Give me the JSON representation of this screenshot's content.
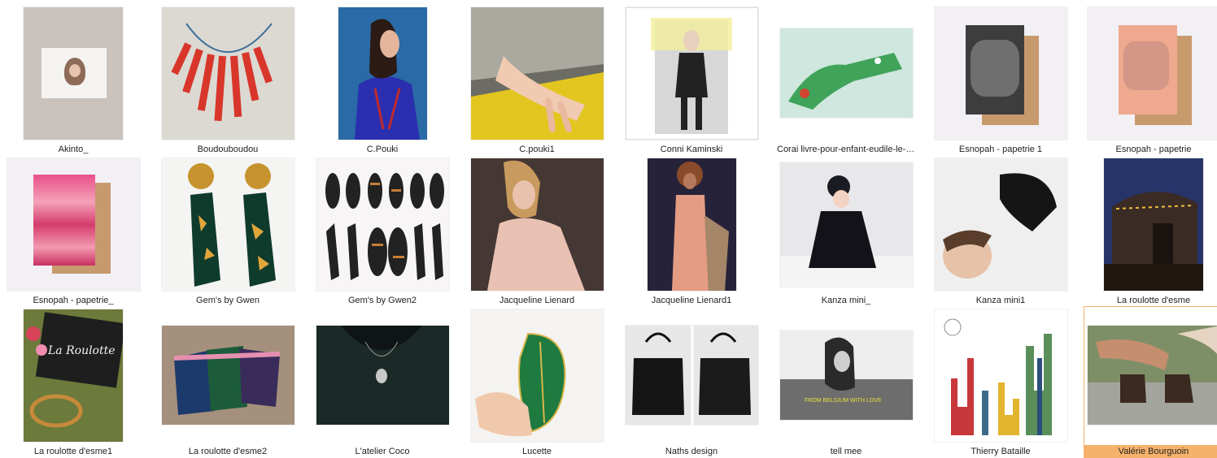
{
  "window": {
    "selected_index": 23,
    "accent_color": "#f6b26b"
  },
  "items": [
    {
      "label": "Akinto_",
      "icon": "image-file-icon"
    },
    {
      "label": "Boudouboudou",
      "icon": "image-file-icon"
    },
    {
      "label": "C.Pouki",
      "icon": "image-file-icon"
    },
    {
      "label": "C.pouki1",
      "icon": "image-file-icon"
    },
    {
      "label": "Conni Kaminski",
      "icon": "image-file-icon"
    },
    {
      "label": "Corai livre-pour-enfant-eudile-le-cr...",
      "icon": "image-file-icon"
    },
    {
      "label": "Esnopah - papetrie 1",
      "icon": "image-file-icon"
    },
    {
      "label": "Esnopah - papetrie",
      "icon": "image-file-icon"
    },
    {
      "label": "Esnopah - papetrie_",
      "icon": "image-file-icon"
    },
    {
      "label": "Gem's by Gwen",
      "icon": "image-file-icon"
    },
    {
      "label": "Gem's by Gwen2",
      "icon": "image-file-icon"
    },
    {
      "label": "Jacqueline Lienard",
      "icon": "image-file-icon"
    },
    {
      "label": "Jacqueline Lienard1",
      "icon": "image-file-icon"
    },
    {
      "label": "Kanza mini_",
      "icon": "image-file-icon"
    },
    {
      "label": "Kanza mini1",
      "icon": "image-file-icon"
    },
    {
      "label": "La roulotte d'esme",
      "icon": "image-file-icon"
    },
    {
      "label": "La roulotte d'esme1",
      "icon": "image-file-icon"
    },
    {
      "label": "La roulotte d'esme2",
      "icon": "image-file-icon"
    },
    {
      "label": "L'atelier Coco",
      "icon": "image-file-icon"
    },
    {
      "label": "Lucette",
      "icon": "image-file-icon"
    },
    {
      "label": "Naths design",
      "icon": "image-file-icon"
    },
    {
      "label": "tell mee",
      "icon": "image-file-icon"
    },
    {
      "label": "Thierry Bataille",
      "icon": "image-file-icon"
    },
    {
      "label": "Valérie Bourguoin",
      "icon": "image-file-icon"
    }
  ],
  "thumb_text": {
    "tell_mee_banner": "FROM BELGIUM WITH LOVE",
    "roulotte_sign": "La Roulotte"
  }
}
